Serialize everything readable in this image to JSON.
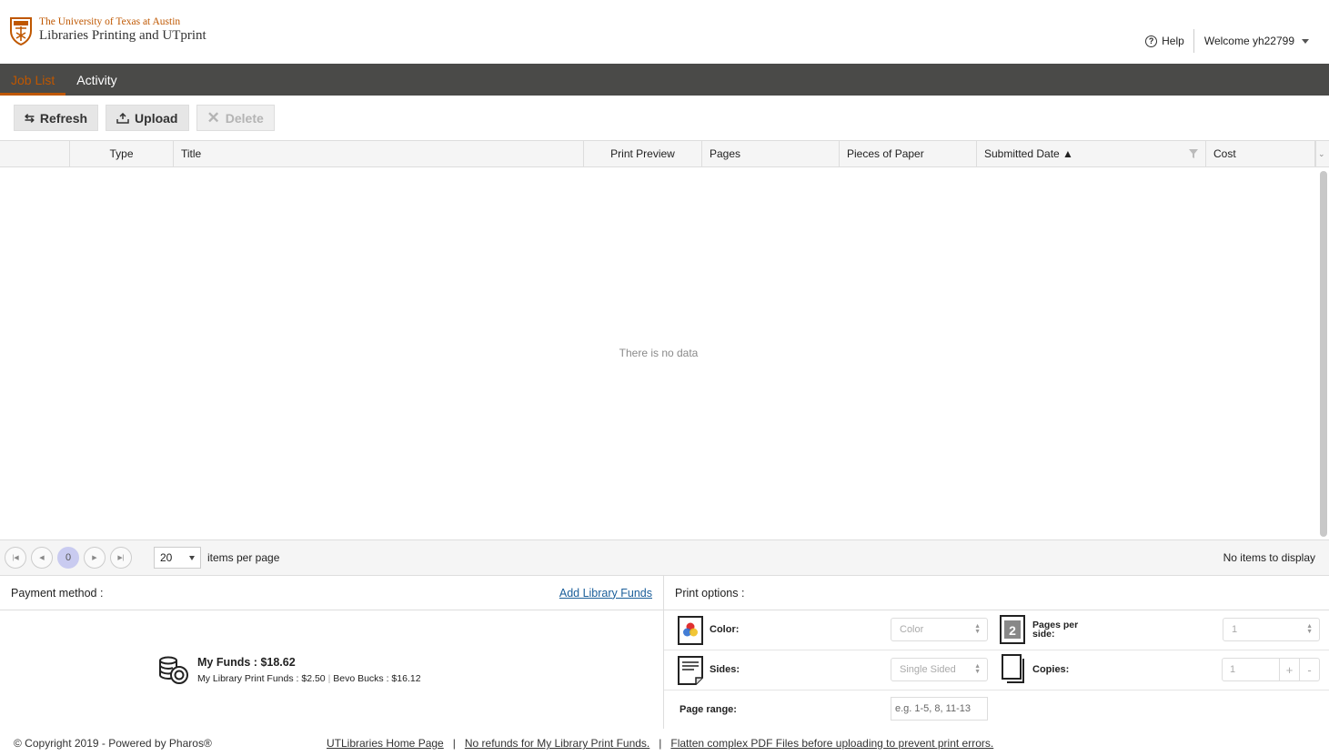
{
  "header": {
    "logo_line1": "The University of Texas at Austin",
    "logo_line2": "Libraries Printing and UTprint",
    "help_label": "Help",
    "welcome_label": "Welcome yh22799"
  },
  "nav": {
    "tabs": [
      {
        "label": "Job List",
        "active": true
      },
      {
        "label": "Activity",
        "active": false
      }
    ]
  },
  "toolbar": {
    "refresh_label": "Refresh",
    "upload_label": "Upload",
    "delete_label": "Delete"
  },
  "grid": {
    "columns": [
      "",
      "Type",
      "Title",
      "Print Preview",
      "Pages",
      "Pieces of Paper",
      "Submitted Date ▲",
      "Cost"
    ],
    "empty_message": "There is no data"
  },
  "pager": {
    "current_page": "0",
    "page_size": "20",
    "items_per_page_label": "items per page",
    "info": "No items to display"
  },
  "payment": {
    "title": "Payment method :",
    "add_funds_label": "Add Library Funds",
    "funds_title": "My Funds : $18.62",
    "funds_breakdown_1": "My Library Print Funds : $2.50",
    "funds_breakdown_2": "Bevo Bucks : $16.12"
  },
  "print_options": {
    "title": "Print options :",
    "color_label": "Color:",
    "color_value": "Color",
    "pages_per_side_label": "Pages per side:",
    "pages_per_side_value": "1",
    "sides_label": "Sides:",
    "sides_value": "Single Sided",
    "copies_label": "Copies:",
    "copies_value": "1",
    "page_range_label": "Page range:",
    "page_range_placeholder": "e.g. 1-5, 8, 11-13"
  },
  "footer": {
    "copyright": "© Copyright 2019 - Powered by Pharos®",
    "link_home": "UTLibraries Home Page",
    "link_refunds": "No refunds for My Library Print Funds.",
    "link_flatten": "Flatten complex PDF Files before uploading to prevent print errors."
  },
  "colors": {
    "accent": "#bf5700",
    "nav_bg": "#4a4a48",
    "link": "#1a5e9a"
  }
}
